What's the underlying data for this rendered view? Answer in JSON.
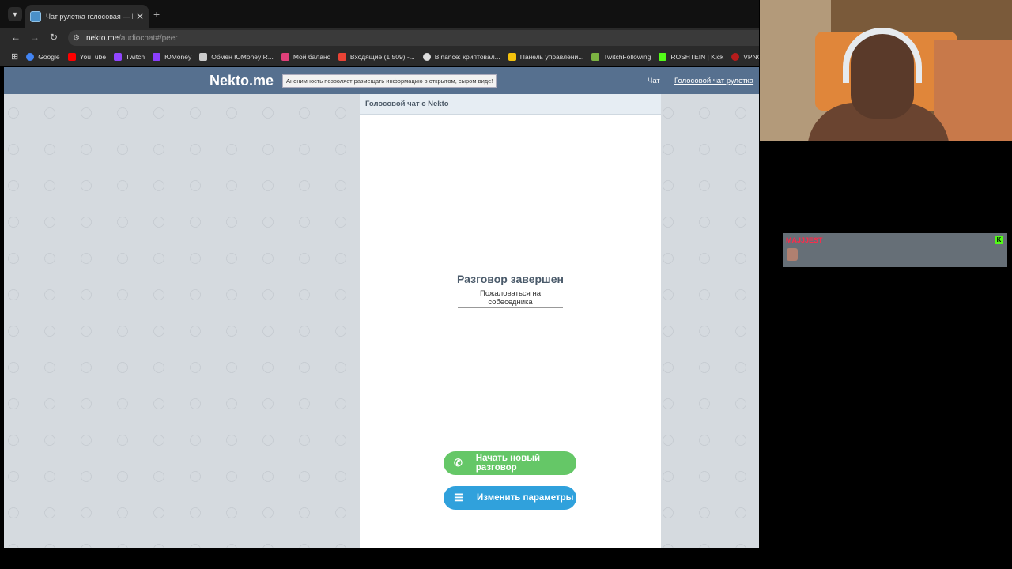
{
  "browser": {
    "tab_title": "Чат рулетка голосовая — Nek",
    "url_host": "nekto.me",
    "url_path": "/audiochat#/peer",
    "bookmarks": [
      {
        "label": "Google",
        "color": "#4285f4"
      },
      {
        "label": "YouTube",
        "color": "#ff0000"
      },
      {
        "label": "Twitch",
        "color": "#9146ff"
      },
      {
        "label": "ЮMoney",
        "color": "#8b3ffd"
      },
      {
        "label": "Обмен ЮMoney R...",
        "color": "#cccccc"
      },
      {
        "label": "Мой баланс",
        "color": "#e0407a"
      },
      {
        "label": "Входящие (1 509) -...",
        "color": "#ea4335"
      },
      {
        "label": "Binance: криптовал...",
        "color": "#dddddd"
      },
      {
        "label": "Панель управлени...",
        "color": "#f4c20d"
      },
      {
        "label": "TwitchFollowing",
        "color": "#7cb342"
      },
      {
        "label": "ROSHTEIN | Kick",
        "color": "#53fc18"
      },
      {
        "label": "VPNGame",
        "color": "#b71c1c"
      }
    ]
  },
  "site": {
    "logo": "Nekto.me",
    "motto": "Анонимность позволяет размещать информацию в открытом, сыром виде!",
    "nav": {
      "chat": "Чат",
      "voice": "Голосовой чат рулетка"
    }
  },
  "panel": {
    "title": "Голосовой чат с Nekto",
    "status": "Разговор завершен",
    "report": "Пожаловаться на собеседника",
    "btn_new": "Начать новый разговор",
    "btn_params": "Изменить параметры"
  },
  "overlay": {
    "chat_user": "MAJJJEST",
    "badge": "K"
  }
}
